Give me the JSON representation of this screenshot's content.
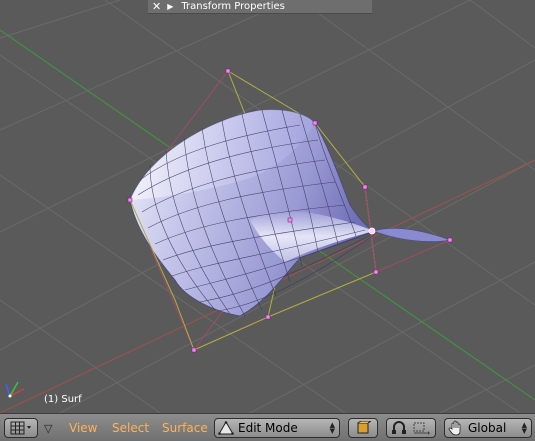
{
  "panel": {
    "close_icon": "close-x-icon",
    "collapse_icon": "triangle-right-icon",
    "title": "Transform Properties"
  },
  "viewport": {
    "object_label": "(1) Surf",
    "axis_gizmo": "xyz-axes-icon"
  },
  "header": {
    "menus": [
      "View",
      "Select",
      "Surface"
    ],
    "mode": {
      "icon": "edit-mode-icon",
      "label": "Edit Mode"
    },
    "icons": [
      "viewport-type-icon",
      "collapse-menu-icon",
      "draw-mode-icon",
      "pivot-icon",
      "manipulator-icon",
      "grab-hand-icon"
    ],
    "orientation": "Global"
  },
  "colors": {
    "grid_line": "#6a6a6a",
    "x_axis": "#a05050",
    "y_axis": "#3c9a3c",
    "control_polygon": "#b0b040",
    "control_point": "#ff80ff",
    "surface_light": "#f4f4ff",
    "surface_dark": "#6e6eb0",
    "menu_text": "#ffb35a"
  }
}
